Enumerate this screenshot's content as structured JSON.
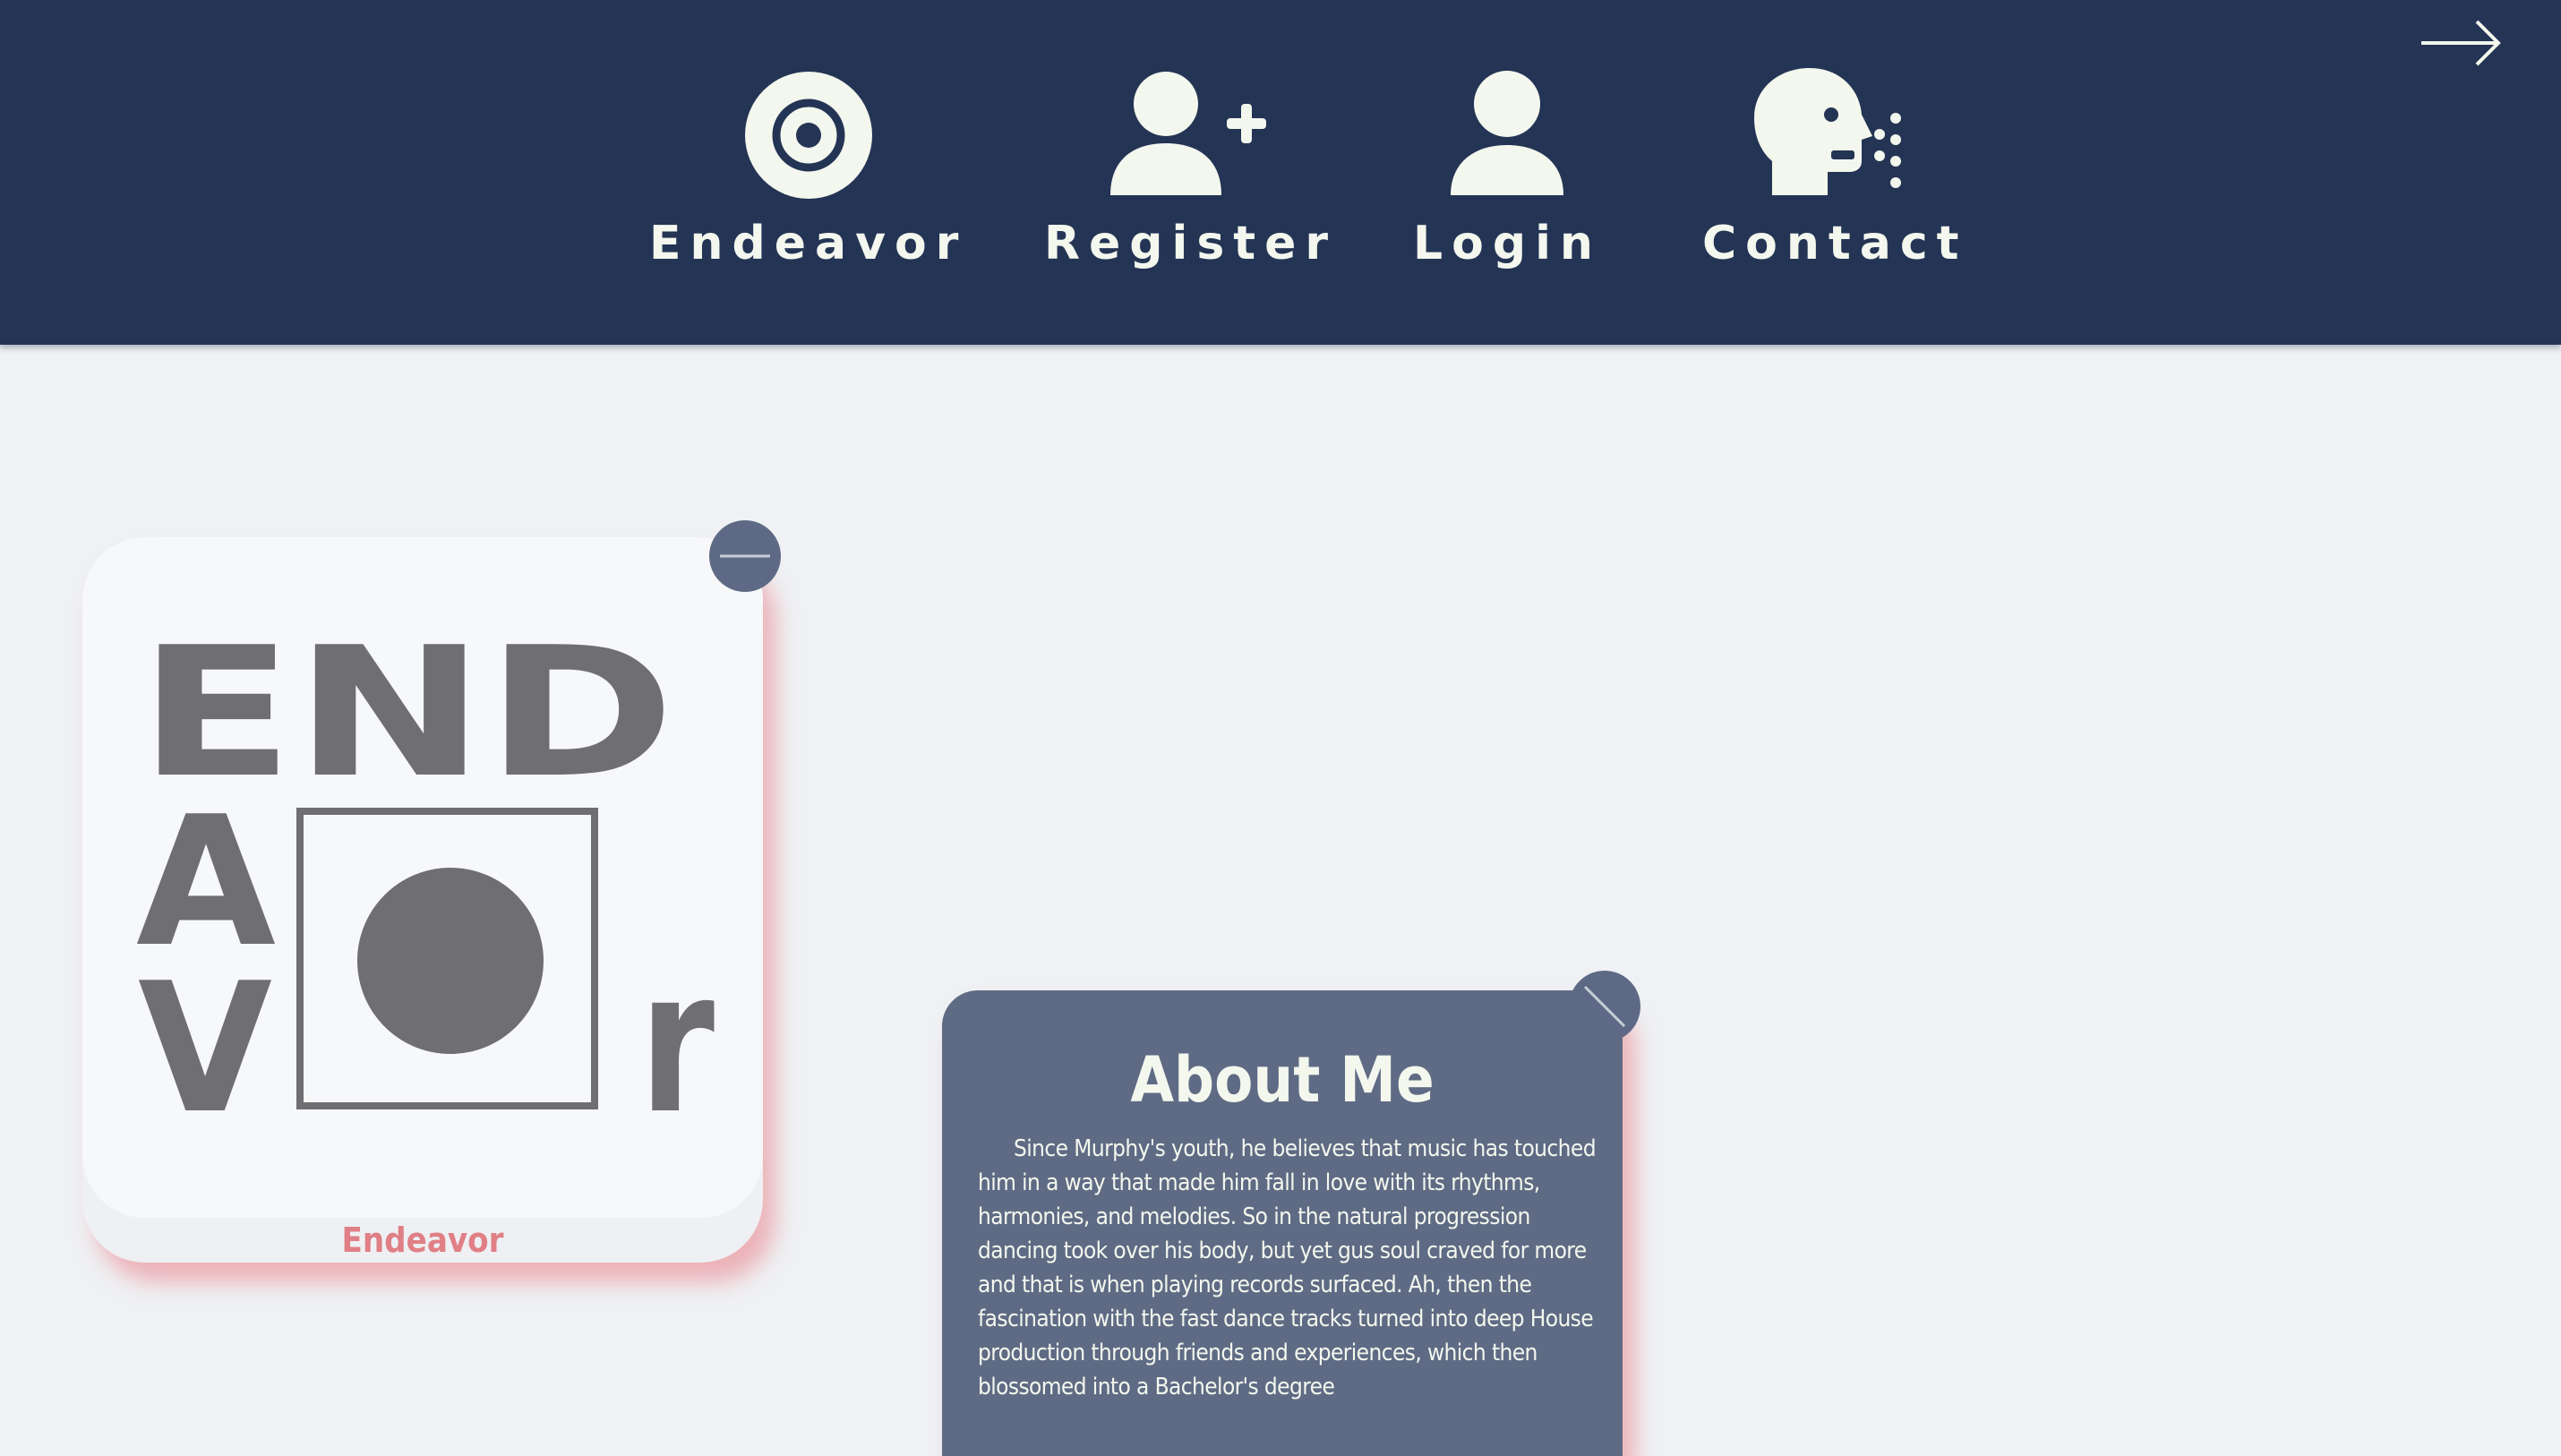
{
  "nav": {
    "items": [
      {
        "label": "Endeavor",
        "icon": "target-icon"
      },
      {
        "label": "Register",
        "icon": "user-plus-icon"
      },
      {
        "label": "Login",
        "icon": "user-icon"
      },
      {
        "label": "Contact",
        "icon": "speaking-head-icon"
      }
    ],
    "exit_icon": "arrow-right-icon"
  },
  "logo_card": {
    "logo_text": "ENDAVORr",
    "caption": "Endeavor",
    "button_icon": "minus-icon"
  },
  "about_card": {
    "title": "About Me",
    "body": "Since Murphy's youth, he believes that music has touched him in a way that made him fall in love with its rhythms, harmonies, and melodies. So in the natural progression dancing took over his body, but yet gus soul craved for more and that is when playing records surfaced. Ah, then the fascination with the fast dance tracks turned into deep House production through friends and experiences, which then blossomed into a Bachelor's degree",
    "button_icon": "slash-icon"
  },
  "colors": {
    "navbar": "#243454",
    "page_background": "#eff1f4",
    "icon_light": "#f3f7ee",
    "accent_pink": "#e07f85",
    "slate": "#5f6b84",
    "logo_gray": "#6f6f71"
  }
}
